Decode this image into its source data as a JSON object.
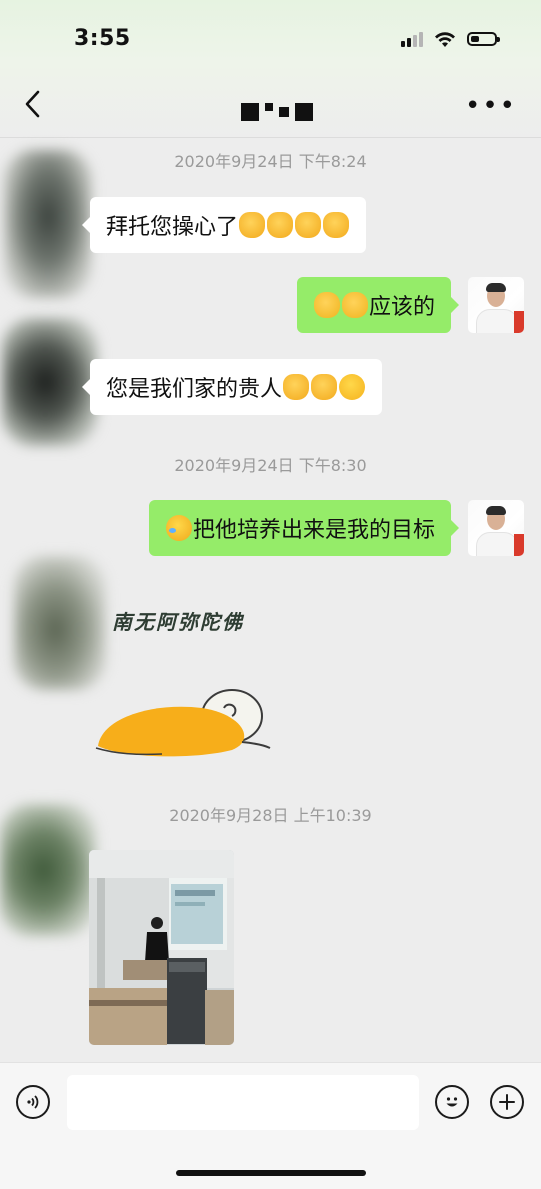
{
  "status_bar": {
    "time": "3:55",
    "battery_level": 0.35
  },
  "header": {
    "title_obscured": true,
    "back_icon": "chevron-left-icon",
    "more_icon": "more-icon"
  },
  "messages": [
    {
      "type": "timestamp",
      "text": "2020年9月24日 下午8:24"
    },
    {
      "type": "text",
      "side": "left",
      "text": "拜托您操心了",
      "emojis": [
        "pray",
        "pray",
        "pray",
        "pray"
      ]
    },
    {
      "type": "text",
      "side": "right",
      "text": "应该的",
      "emojis_before": [
        "ok",
        "ok"
      ]
    },
    {
      "type": "text",
      "side": "left",
      "text": "您是我们家的贵人",
      "emojis": [
        "pray",
        "pray",
        "smile"
      ]
    },
    {
      "type": "timestamp",
      "text": "2020年9月24日 下午8:30"
    },
    {
      "type": "text",
      "side": "right",
      "text": "把他培养出来是我的目标",
      "emojis_before": [
        "laugh-cry"
      ]
    },
    {
      "type": "sticker",
      "side": "left",
      "caption": "南无阿弥陀佛"
    },
    {
      "type": "timestamp",
      "text": "2020年9月28日 上午10:39"
    },
    {
      "type": "image",
      "side": "left",
      "description_icon": "photo-icon"
    }
  ],
  "input_bar": {
    "placeholder": "",
    "voice_icon": "voice-icon",
    "emoji_icon": "emoji-icon",
    "plus_icon": "plus-icon"
  },
  "colors": {
    "right_bubble": "#95ec69",
    "left_bubble": "#ffffff",
    "background": "#ededed"
  }
}
